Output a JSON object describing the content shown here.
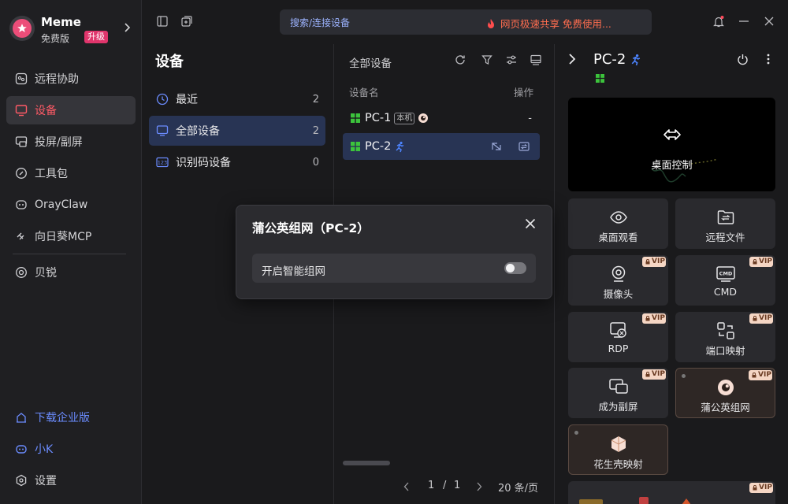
{
  "profile": {
    "name": "Meme",
    "plan": "免费版",
    "upgrade": "升级"
  },
  "sidebar": {
    "items": [
      {
        "label": "远程协助",
        "icon": "remote-assist-icon"
      },
      {
        "label": "设备",
        "icon": "monitor-icon",
        "active": true
      },
      {
        "label": "投屏/副屏",
        "icon": "screen-cast-icon"
      },
      {
        "label": "工具包",
        "icon": "toolkit-icon"
      },
      {
        "label": "OrayClaw",
        "icon": "oray-claw-icon"
      },
      {
        "label": "向日葵MCP",
        "icon": "mcp-icon"
      },
      {
        "label": "贝锐",
        "icon": "beirui-icon"
      }
    ],
    "bottom": [
      {
        "label": "下载企业版",
        "icon": "download-enterprise-icon"
      },
      {
        "label": "小K",
        "icon": "assistant-robot-icon"
      },
      {
        "label": "设置",
        "icon": "settings-gear-icon"
      }
    ]
  },
  "topbar": {
    "search_placeholder": "搜索/连接设备",
    "promo": "网页极速共享 免费使用..."
  },
  "devices_nav": {
    "title": "设备",
    "categories": [
      {
        "label": "最近",
        "count": "2"
      },
      {
        "label": "全部设备",
        "count": "2",
        "active": true
      },
      {
        "label": "识别码设备",
        "count": "0"
      }
    ]
  },
  "device_list": {
    "title": "全部设备",
    "col_name": "设备名",
    "col_op": "操作",
    "rows": [
      {
        "name": "PC-1",
        "tag": "本机",
        "op": "-"
      },
      {
        "name": "PC-2",
        "selected": true
      }
    ],
    "pagination": {
      "current": "1",
      "separator": "/",
      "total": "1",
      "page_size": "20 条/页"
    }
  },
  "detail": {
    "name": "PC-2",
    "desktop_control": "桌面控制",
    "tiles": [
      {
        "label": "桌面观看",
        "icon": "eye-icon",
        "vip": false
      },
      {
        "label": "远程文件",
        "icon": "remote-file-icon",
        "vip": false
      },
      {
        "label": "摄像头",
        "icon": "camera-icon",
        "vip": true
      },
      {
        "label": "CMD",
        "icon": "cmd-icon",
        "vip": true
      },
      {
        "label": "RDP",
        "icon": "rdp-icon",
        "vip": true
      },
      {
        "label": "端口映射",
        "icon": "port-mapping-icon",
        "vip": true
      },
      {
        "label": "成为副屏",
        "icon": "second-screen-icon",
        "vip": true
      },
      {
        "label": "蒲公英组网",
        "icon": "pgy-network-icon",
        "vip": true
      },
      {
        "label": "花生壳映射",
        "icon": "peanut-shell-icon",
        "vip": false
      }
    ],
    "vip_label": "VIP"
  },
  "modal": {
    "title": "蒲公英组网（PC-2）",
    "option_label": "开启智能组网",
    "toggle_on": false
  },
  "colors": {
    "accent_red": "#ff5a66",
    "accent_blue": "#6b8cff",
    "selection": "#283454",
    "promo": "#ff6d4f",
    "windows_green": "#3cc43c"
  }
}
